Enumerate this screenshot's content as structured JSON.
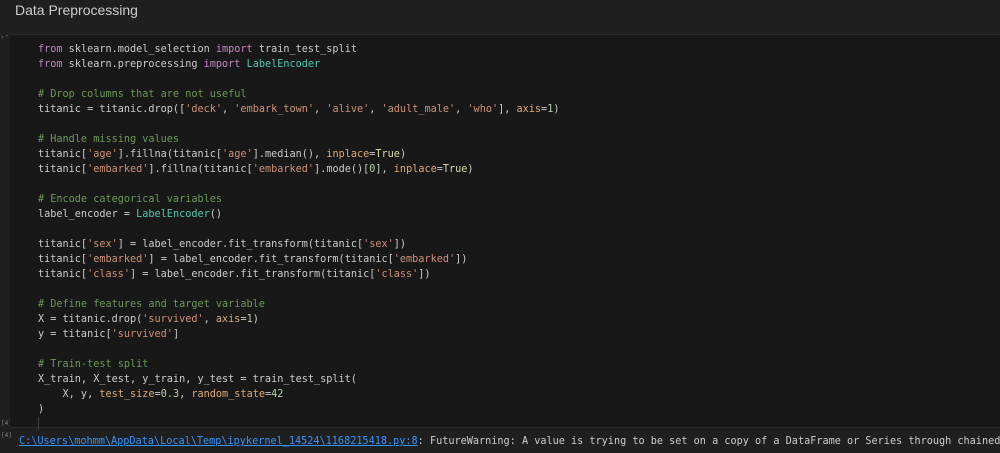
{
  "markdown": {
    "heading": "Data Preprocessing"
  },
  "cell": {
    "gutter": {
      "collapse_arrow": "›",
      "collapse_dash": "-",
      "exec_marker": "[4]"
    },
    "lines": [
      [
        [
          "kw",
          "from"
        ],
        [
          "id",
          " sklearn.model_selection "
        ],
        [
          "kw",
          "import"
        ],
        [
          "id",
          " train_test_split"
        ]
      ],
      [
        [
          "kw",
          "from"
        ],
        [
          "id",
          " sklearn.preprocessing "
        ],
        [
          "kw",
          "import"
        ],
        [
          "id",
          " "
        ],
        [
          "cls",
          "LabelEncoder"
        ]
      ],
      [],
      [
        [
          "com",
          "# Drop columns that are not useful"
        ]
      ],
      [
        [
          "id",
          "titanic = titanic.drop(["
        ],
        [
          "str",
          "'deck'"
        ],
        [
          "id",
          ", "
        ],
        [
          "str",
          "'embark_town'"
        ],
        [
          "id",
          ", "
        ],
        [
          "str",
          "'alive'"
        ],
        [
          "id",
          ", "
        ],
        [
          "str",
          "'adult_male'"
        ],
        [
          "id",
          ", "
        ],
        [
          "str",
          "'who'"
        ],
        [
          "id",
          "], "
        ],
        [
          "param",
          "axis"
        ],
        [
          "id",
          "="
        ],
        [
          "num",
          "1"
        ],
        [
          "id",
          ")"
        ]
      ],
      [],
      [
        [
          "com",
          "# Handle missing values"
        ]
      ],
      [
        [
          "id",
          "titanic["
        ],
        [
          "str",
          "'age'"
        ],
        [
          "id",
          "].fillna(titanic["
        ],
        [
          "str",
          "'age'"
        ],
        [
          "id",
          "].median(), "
        ],
        [
          "param",
          "inplace"
        ],
        [
          "id",
          "="
        ],
        [
          "const",
          "True"
        ],
        [
          "id",
          ")"
        ]
      ],
      [
        [
          "id",
          "titanic["
        ],
        [
          "str",
          "'embarked'"
        ],
        [
          "id",
          "].fillna(titanic["
        ],
        [
          "str",
          "'embarked'"
        ],
        [
          "id",
          "].mode()["
        ],
        [
          "num",
          "0"
        ],
        [
          "id",
          "], "
        ],
        [
          "param",
          "inplace"
        ],
        [
          "id",
          "="
        ],
        [
          "const",
          "True"
        ],
        [
          "id",
          ")"
        ]
      ],
      [],
      [
        [
          "com",
          "# Encode categorical variables"
        ]
      ],
      [
        [
          "id",
          "label_encoder = "
        ],
        [
          "cls",
          "LabelEncoder"
        ],
        [
          "id",
          "()"
        ]
      ],
      [],
      [
        [
          "id",
          "titanic["
        ],
        [
          "str",
          "'sex'"
        ],
        [
          "id",
          "] = label_encoder.fit_transform(titanic["
        ],
        [
          "str",
          "'sex'"
        ],
        [
          "id",
          "])"
        ]
      ],
      [
        [
          "id",
          "titanic["
        ],
        [
          "str",
          "'embarked'"
        ],
        [
          "id",
          "] = label_encoder.fit_transform(titanic["
        ],
        [
          "str",
          "'embarked'"
        ],
        [
          "id",
          "])"
        ]
      ],
      [
        [
          "id",
          "titanic["
        ],
        [
          "str",
          "'class'"
        ],
        [
          "id",
          "] = label_encoder.fit_transform(titanic["
        ],
        [
          "str",
          "'class'"
        ],
        [
          "id",
          "])"
        ]
      ],
      [],
      [
        [
          "com",
          "# Define features and target variable"
        ]
      ],
      [
        [
          "id",
          "X = titanic.drop("
        ],
        [
          "str",
          "'survived'"
        ],
        [
          "id",
          ", "
        ],
        [
          "param",
          "axis"
        ],
        [
          "id",
          "="
        ],
        [
          "num",
          "1"
        ],
        [
          "id",
          ")"
        ]
      ],
      [
        [
          "id",
          "y = titanic["
        ],
        [
          "str",
          "'survived'"
        ],
        [
          "id",
          "]"
        ]
      ],
      [],
      [
        [
          "com",
          "# Train-test split"
        ]
      ],
      [
        [
          "id",
          "X_train, X_test, y_train, y_test = train_test_split("
        ]
      ],
      [
        [
          "id",
          "    X, y, "
        ],
        [
          "param",
          "test_size"
        ],
        [
          "id",
          "="
        ],
        [
          "num",
          "0.3"
        ],
        [
          "id",
          ", "
        ],
        [
          "param",
          "random_state"
        ],
        [
          "id",
          "="
        ],
        [
          "num",
          "42"
        ]
      ],
      [
        [
          "id",
          ")"
        ]
      ]
    ]
  },
  "output": {
    "marker": "[4]",
    "path_link": "C:\\Users\\mohmm\\AppData\\Local\\Temp\\ipykernel_14524\\1168215418.py:8",
    "message": ": FutureWarning: A value is trying to be set on a copy of a DataFrame or Series through chained"
  },
  "colors": {
    "background": "#1f1f1f",
    "cell_background": "#181818",
    "keyword": "#c586c0",
    "string": "#ce9178",
    "number": "#b5cea8",
    "comment": "#6a9955",
    "parameter": "#ddaa77",
    "constant": "#dcdcaa",
    "class": "#4ec9b0",
    "link": "#3794ff"
  }
}
